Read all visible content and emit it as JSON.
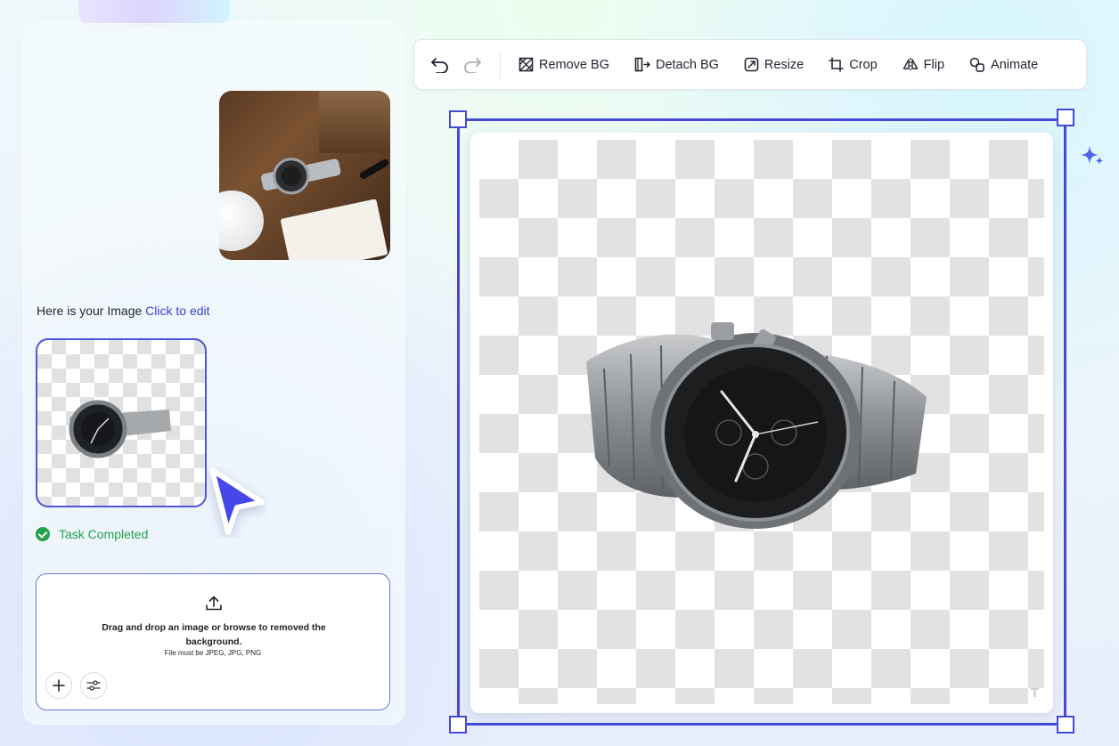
{
  "colors": {
    "accent": "#4549d6",
    "link": "#3a3fd1",
    "success": "#22a34a"
  },
  "chat": {
    "prompt": "Here is your Image",
    "edit_link": "Click to edit",
    "status": "Task Completed"
  },
  "upload": {
    "line1": "Drag and drop an image or browse to removed the background.",
    "line2": "File must be JPEG, JPG, PNG",
    "icons": [
      "upload-icon",
      "plus-icon",
      "sliders-icon"
    ]
  },
  "toolbar": {
    "tools": [
      {
        "label": "Remove BG",
        "icon": "remove-bg-icon"
      },
      {
        "label": "Detach BG",
        "icon": "detach-bg-icon"
      },
      {
        "label": "Resize",
        "icon": "resize-icon"
      },
      {
        "label": "Crop",
        "icon": "crop-icon"
      },
      {
        "label": "Flip",
        "icon": "flip-icon"
      },
      {
        "label": "Animate",
        "icon": "animate-icon"
      }
    ]
  },
  "canvas": {
    "text_tool": "T"
  }
}
